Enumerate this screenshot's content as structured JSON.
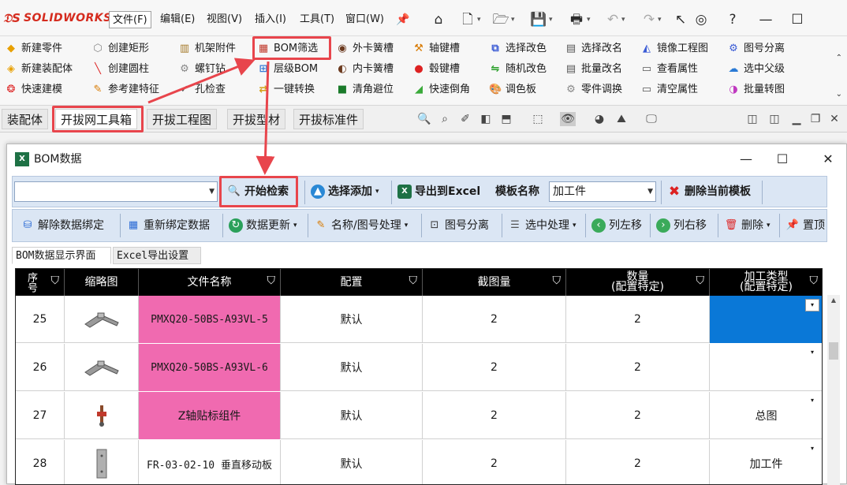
{
  "app": {
    "logo": "SOLIDWORKS"
  },
  "menu": {
    "items": [
      "文件(F)",
      "编辑(E)",
      "视图(V)",
      "插入(I)",
      "工具(T)",
      "窗口(W)"
    ]
  },
  "ribbon": {
    "col1": [
      "新建零件",
      "新建装配体",
      "快速建模"
    ],
    "col2": [
      "创建矩形",
      "创建圆柱",
      "参考建特征"
    ],
    "col3": [
      "机架附件",
      "螺钉钻",
      "孔检查"
    ],
    "col4": [
      "BOM筛选",
      "层级BOM",
      "一键转换"
    ],
    "col5": [
      "外卡簧槽",
      "内卡簧槽",
      "清角避位"
    ],
    "col6": [
      "轴键槽",
      "毂键槽",
      "快速倒角"
    ],
    "col7": [
      "选择改色",
      "随机改色",
      "调色板"
    ],
    "col8": [
      "选择改名",
      "批量改名",
      "零件调换"
    ],
    "col9": [
      "镜像工程图",
      "查看属性",
      "清空属性"
    ],
    "col10": [
      "图号分离",
      "选中父级",
      "批量转图"
    ]
  },
  "tabs": [
    "装配体",
    "开拔网工具箱",
    "开拔工程图",
    "开拔型材",
    "开拔标准件"
  ],
  "bom": {
    "title": "BOM数据",
    "toolbar1": {
      "search_label": "开始检索",
      "select_add": "选择添加",
      "export_excel": "导出到Excel",
      "template_label": "模板名称",
      "template_value": "加工件",
      "delete_template": "删除当前模板"
    },
    "toolbar2": {
      "unbind": "解除数据绑定",
      "rebind": "重新绑定数据",
      "update": "数据更新",
      "name_process": "名称/图号处理",
      "drawing_split": "图号分离",
      "selected_process": "选中处理",
      "col_left": "列左移",
      "col_right": "列右移",
      "delete": "删除",
      "pin_top": "置顶"
    },
    "subtabs": [
      "BOM数据显示界面",
      "Excel导出设置"
    ],
    "columns": {
      "seq": "序号",
      "thumb": "缩略图",
      "filename": "文件名称",
      "config": "配置",
      "cut_qty": "截图量",
      "qty_line1": "数量",
      "qty_line2": "(配置特定)",
      "ptype_line1": "加工类型",
      "ptype_line2": "(配置特定)"
    },
    "rows": [
      {
        "seq": "25",
        "filename": "PMXQ20-50BS-A93VL-5",
        "config": "默认",
        "cut_qty": "2",
        "qty": "2",
        "ptype": ""
      },
      {
        "seq": "26",
        "filename": "PMXQ20-50BS-A93VL-6",
        "config": "默认",
        "cut_qty": "2",
        "qty": "2",
        "ptype": ""
      },
      {
        "seq": "27",
        "filename": "Z轴贴标组件",
        "config": "默认",
        "cut_qty": "2",
        "qty": "2",
        "ptype": "总图"
      },
      {
        "seq": "28",
        "filename": "FR-03-02-10 垂直移动板",
        "config": "默认",
        "cut_qty": "2",
        "qty": "2",
        "ptype": "加工件"
      }
    ]
  },
  "colors": {
    "highlight": "#e8454c",
    "pink": "#f06ab0",
    "selected": "#0a78d7",
    "toolbar": "#dbe6f4"
  }
}
